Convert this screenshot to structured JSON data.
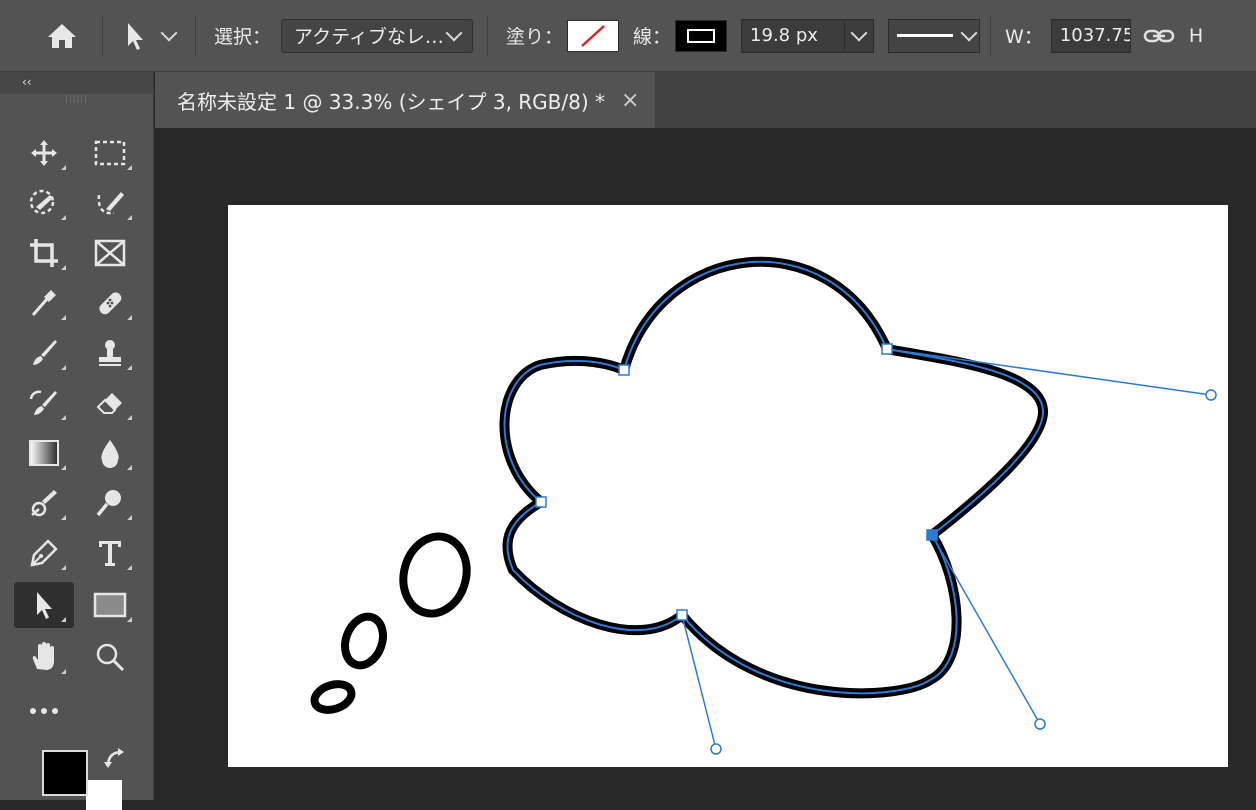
{
  "options_bar": {
    "select_label": "選択：",
    "select_value": "アクティブなレ…",
    "fill_label": "塗り：",
    "stroke_label": "線：",
    "stroke_width": "19.8 px",
    "w_label": "W：",
    "w_value": "1037.75",
    "h_label": "H"
  },
  "toolbox": {
    "collapse": "‹‹",
    "grip": "||||||"
  },
  "document": {
    "tab_title": "名称未設定 1 @ 33.3% (シェイプ 3, RGB/8) *",
    "close_label": "×"
  },
  "colors": {
    "ui_bg": "#535353",
    "pasteboard": "#282828",
    "path_blue": "#2b7bd6",
    "stroke": "#000000",
    "no_fill_red": "#e02020"
  },
  "icons": {
    "home": "home-icon",
    "arrow": "direct-select-arrow-icon",
    "link": "link-icon",
    "move": "move-icon",
    "marquee": "rect-marquee-icon",
    "lasso": "object-select-icon",
    "quick_select": "quick-select-icon",
    "crop": "crop-icon",
    "frame": "frame-icon",
    "eyedropper": "eyedropper-icon",
    "healing": "healing-icon",
    "brush": "brush-icon",
    "stamp": "clone-stamp-icon",
    "history_brush": "history-brush-icon",
    "eraser": "eraser-icon",
    "gradient": "gradient-icon",
    "blur": "blur-icon",
    "dodge": "dodge-icon",
    "sponge": "sponge-icon",
    "pen": "pen-icon",
    "type": "type-icon",
    "path_select": "path-select-icon",
    "rectangle": "rectangle-icon",
    "hand": "hand-icon",
    "zoom": "zoom-icon",
    "more": "more-icon",
    "swap": "swap-colors-icon"
  }
}
